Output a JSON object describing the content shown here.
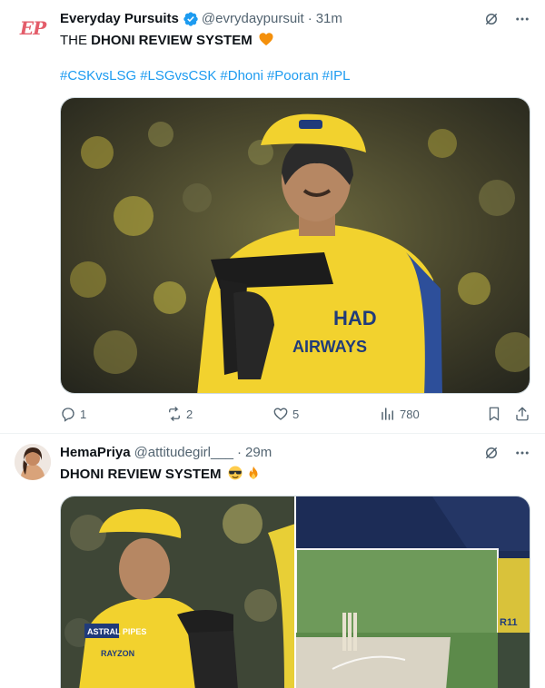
{
  "tweets": [
    {
      "author": {
        "name": "Everyday Pursuits",
        "handle": "@evrydaypursuit",
        "verified": true,
        "avatar_text": "EP"
      },
      "time": "31m",
      "text": {
        "prefix": "THE ",
        "bold": "DHONI REVIEW SYSTEM",
        "emoji": "orange-heart"
      },
      "hashtags": [
        "#CSKvsLSG",
        "#LSGvsCSK",
        "#Dhoni",
        "#Pooran",
        "#IPL"
      ],
      "media": {
        "jersey_text": "AIRWAYS",
        "sponsor_text": "HAD"
      },
      "actions": {
        "replies": "1",
        "reposts": "2",
        "likes": "5",
        "views": "780"
      }
    },
    {
      "author": {
        "name": "HemaPriya",
        "handle": "@attitudegirl___",
        "verified": false
      },
      "time": "29m",
      "text": {
        "bold": "DHONI REVIEW SYSTEM",
        "emojis": [
          "sunglasses-face",
          "fire"
        ]
      },
      "media": {
        "badge_left": "ASTRAL PIPES",
        "badge_right": "RAYZON",
        "right_panel_text": "R11"
      }
    }
  ],
  "icons": {
    "grok": "grok-icon",
    "more": "more-icon",
    "reply": "reply-icon",
    "repost": "repost-icon",
    "like": "like-icon",
    "views": "views-icon",
    "bookmark": "bookmark-icon",
    "share": "share-icon"
  },
  "colors": {
    "link": "#1d9bf0",
    "verified": "#1d9bf0",
    "secondary_text": "#536471",
    "csk_yellow": "#f2d22e"
  }
}
